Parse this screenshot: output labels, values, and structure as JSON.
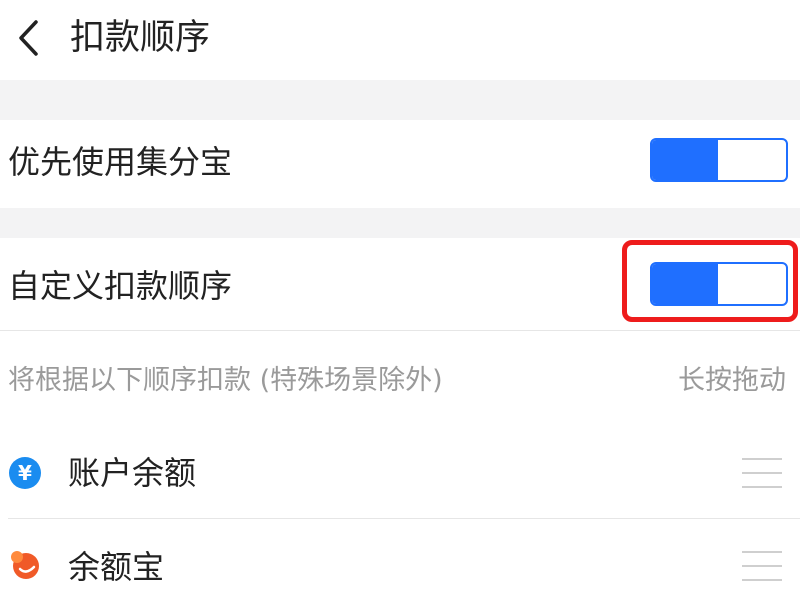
{
  "header": {
    "title": "扣款顺序",
    "back_icon": "chevron-left-icon"
  },
  "settings": {
    "use_jifenbao": {
      "label": "优先使用集分宝",
      "enabled": true
    },
    "custom_order": {
      "label": "自定义扣款顺序",
      "enabled": true
    }
  },
  "order_hint": {
    "text": "将根据以下顺序扣款 (特殊场景除外)",
    "action": "长按拖动"
  },
  "payment_methods": [
    {
      "label": "账户余额",
      "icon": "yuan-icon",
      "icon_color": "#1a8cf0"
    },
    {
      "label": "余额宝",
      "icon": "yuebao-icon",
      "icon_color": "#f05a28"
    }
  ],
  "colors": {
    "accent": "#1f6fff",
    "highlight": "#ee1c1c",
    "section_gap": "#f3f3f4",
    "hint_text": "#9a9a9a"
  }
}
